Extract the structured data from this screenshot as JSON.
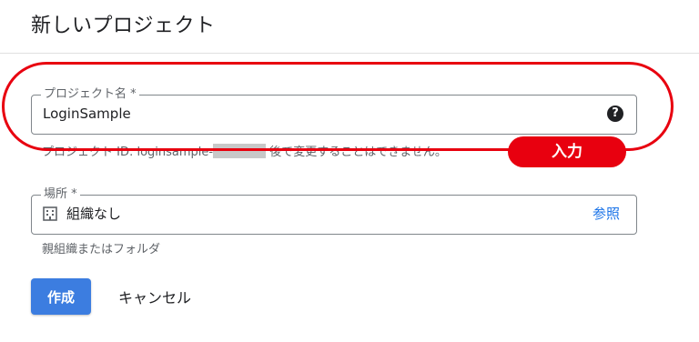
{
  "page": {
    "title": "新しいプロジェクト"
  },
  "project_name": {
    "label": "プロジェクト名 *",
    "value": "LoginSample",
    "help_icon": "question-circle-icon",
    "hint_prefix": "プロジェクト ID: loginsample-",
    "hint_suffix": " 後で変更することはできません。"
  },
  "annotation": {
    "tag": "入力",
    "color": "#e8000f"
  },
  "location": {
    "label": "場所 *",
    "icon": "building-icon",
    "value": "組織なし",
    "browse_label": "参照",
    "hint": "親組織またはフォルダ"
  },
  "actions": {
    "create_label": "作成",
    "cancel_label": "キャンセル",
    "primary_color": "#3c7de0",
    "link_color": "#1a73e8"
  }
}
